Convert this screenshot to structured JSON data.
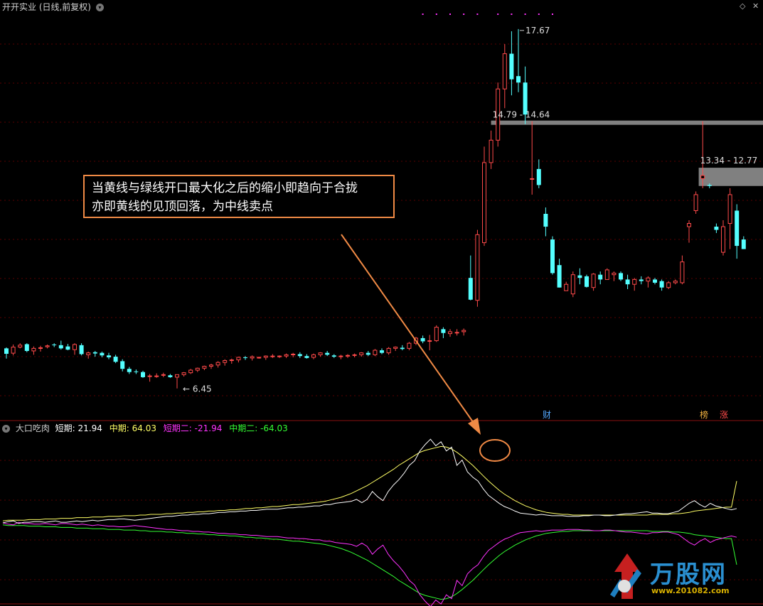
{
  "header": {
    "title": "开开实业 (日线,前复权)",
    "collapse_icon": "chevron-down-icon",
    "corner_icons": [
      "diamond-icon",
      "close-icon"
    ]
  },
  "colors": {
    "up": "#ff4a4a",
    "down": "#54ffff",
    "short_line": "#ffffff",
    "mid_line": "#ffff66",
    "short2_line": "#ff33ff",
    "mid2_line": "#33ff33",
    "grid": "#5a0000",
    "annotation": "#f08a45",
    "resistance_band": "#808080"
  },
  "annotation": {
    "line1": "当黄线与绿线开口最大化之后的缩小即趋向于合拢",
    "line2": "亦即黄线的见顶回落，为中线卖点"
  },
  "price_labels": {
    "high": "17.67",
    "low": "6.45",
    "band1": "14.79 - 14.64",
    "band2": "13.34 - 12.77"
  },
  "markers": {
    "finance": "财",
    "rank": "榜",
    "rise": "涨"
  },
  "indicator": {
    "name": "大口吃肉",
    "items": [
      {
        "label": "短期:",
        "value": "21.94",
        "color": "#ffffff"
      },
      {
        "label": "中期:",
        "value": "64.03",
        "color": "#ffff66"
      },
      {
        "label": "短期二:",
        "value": "-21.94",
        "color": "#ff33ff"
      },
      {
        "label": "中期二:",
        "value": "-64.03",
        "color": "#33ff33"
      }
    ]
  },
  "logo": {
    "text": "万股网",
    "url": "www.201082.com"
  },
  "chart_data": {
    "type": "candlestick",
    "price_range": [
      6.0,
      18.0
    ],
    "x_index_range": [
      0,
      111
    ],
    "candles_ohlc": [
      [
        7.7,
        7.73,
        7.38,
        7.53
      ],
      [
        7.55,
        7.82,
        7.48,
        7.74
      ],
      [
        7.74,
        7.86,
        7.7,
        7.8
      ],
      [
        7.83,
        7.86,
        7.58,
        7.62
      ],
      [
        7.62,
        7.76,
        7.5,
        7.7
      ],
      [
        7.7,
        7.78,
        7.6,
        7.72
      ],
      [
        7.75,
        7.82,
        7.7,
        7.78
      ],
      [
        7.82,
        7.86,
        7.74,
        7.8
      ],
      [
        7.8,
        7.94,
        7.66,
        7.7
      ],
      [
        7.76,
        7.84,
        7.64,
        7.66
      ],
      [
        7.66,
        7.86,
        7.5,
        7.82
      ],
      [
        7.8,
        7.86,
        7.48,
        7.52
      ],
      [
        7.5,
        7.6,
        7.38,
        7.56
      ],
      [
        7.58,
        7.62,
        7.44,
        7.54
      ],
      [
        7.56,
        7.6,
        7.42,
        7.48
      ],
      [
        7.48,
        7.56,
        7.36,
        7.42
      ],
      [
        7.44,
        7.5,
        7.24,
        7.28
      ],
      [
        7.3,
        7.36,
        6.98,
        7.06
      ],
      [
        7.06,
        7.12,
        6.9,
        6.96
      ],
      [
        6.98,
        7.04,
        6.9,
        6.96
      ],
      [
        6.96,
        7.0,
        6.78,
        6.8
      ],
      [
        6.82,
        6.9,
        6.66,
        6.84
      ],
      [
        6.84,
        6.92,
        6.78,
        6.84
      ],
      [
        6.86,
        6.94,
        6.8,
        6.88
      ],
      [
        6.86,
        6.9,
        6.78,
        6.8
      ],
      [
        6.8,
        6.86,
        6.45,
        6.88
      ],
      [
        6.88,
        6.96,
        6.82,
        6.94
      ],
      [
        6.94,
        7.06,
        6.9,
        7.02
      ],
      [
        7.02,
        7.1,
        6.96,
        7.08
      ],
      [
        7.08,
        7.16,
        7.02,
        7.14
      ],
      [
        7.14,
        7.22,
        7.06,
        7.18
      ],
      [
        7.18,
        7.3,
        7.1,
        7.26
      ],
      [
        7.26,
        7.36,
        7.16,
        7.32
      ],
      [
        7.32,
        7.38,
        7.22,
        7.34
      ],
      [
        7.34,
        7.44,
        7.26,
        7.42
      ],
      [
        7.42,
        7.46,
        7.34,
        7.4
      ],
      [
        7.4,
        7.48,
        7.32,
        7.44
      ],
      [
        7.42,
        7.44,
        7.38,
        7.42
      ],
      [
        7.42,
        7.48,
        7.34,
        7.46
      ],
      [
        7.46,
        7.52,
        7.4,
        7.46
      ],
      [
        7.46,
        7.48,
        7.4,
        7.46
      ],
      [
        7.46,
        7.54,
        7.4,
        7.5
      ],
      [
        7.5,
        7.56,
        7.42,
        7.52
      ],
      [
        7.52,
        7.58,
        7.4,
        7.46
      ],
      [
        7.46,
        7.52,
        7.38,
        7.4
      ],
      [
        7.42,
        7.54,
        7.36,
        7.5
      ],
      [
        7.5,
        7.58,
        7.44,
        7.56
      ],
      [
        7.56,
        7.62,
        7.46,
        7.5
      ],
      [
        7.48,
        7.52,
        7.4,
        7.44
      ],
      [
        7.44,
        7.5,
        7.36,
        7.46
      ],
      [
        7.46,
        7.52,
        7.4,
        7.48
      ],
      [
        7.48,
        7.54,
        7.42,
        7.5
      ],
      [
        7.5,
        7.58,
        7.44,
        7.56
      ],
      [
        7.56,
        7.62,
        7.46,
        7.5
      ],
      [
        7.5,
        7.68,
        7.46,
        7.64
      ],
      [
        7.64,
        7.7,
        7.52,
        7.56
      ],
      [
        7.56,
        7.74,
        7.5,
        7.7
      ],
      [
        7.7,
        7.76,
        7.62,
        7.74
      ],
      [
        7.72,
        7.8,
        7.64,
        7.68
      ],
      [
        7.7,
        7.9,
        7.64,
        7.86
      ],
      [
        7.86,
        8.06,
        7.8,
        8.02
      ],
      [
        8.02,
        8.1,
        7.86,
        7.92
      ],
      [
        7.92,
        8.12,
        7.64,
        7.94
      ],
      [
        7.94,
        8.42,
        7.9,
        8.36
      ],
      [
        8.3,
        8.36,
        8.02,
        8.18
      ],
      [
        8.16,
        8.3,
        8.06,
        8.22
      ],
      [
        8.18,
        8.3,
        8.1,
        8.2
      ],
      [
        8.22,
        8.32,
        8.1,
        8.26
      ],
      [
        9.9,
        10.6,
        9.2,
        9.22
      ],
      [
        9.2,
        11.4,
        9.0,
        11.25
      ],
      [
        11.0,
        14.0,
        10.9,
        13.5
      ],
      [
        13.5,
        14.5,
        13.3,
        14.2
      ],
      [
        14.2,
        16.0,
        14.0,
        15.8
      ],
      [
        15.8,
        17.2,
        15.2,
        16.9
      ],
      [
        16.9,
        17.6,
        15.6,
        16.1
      ],
      [
        16.2,
        17.67,
        15.7,
        16.0
      ],
      [
        16.0,
        16.5,
        14.7,
        15.0
      ],
      [
        13.0,
        14.79,
        12.5,
        13.0
      ],
      [
        13.3,
        13.6,
        12.7,
        12.8
      ],
      [
        11.9,
        12.1,
        11.2,
        11.5
      ],
      [
        11.1,
        11.2,
        10.0,
        10.05
      ],
      [
        10.3,
        10.5,
        9.6,
        9.6
      ],
      [
        9.5,
        9.78,
        9.5,
        9.7
      ],
      [
        9.4,
        10.1,
        9.3,
        10.0
      ],
      [
        9.98,
        10.2,
        9.7,
        9.9
      ],
      [
        9.95,
        10.0,
        9.6,
        9.62
      ],
      [
        9.6,
        10.05,
        9.5,
        10.02
      ],
      [
        10.0,
        10.1,
        9.7,
        9.85
      ],
      [
        9.85,
        10.2,
        9.85,
        10.15
      ],
      [
        10.0,
        10.1,
        9.8,
        10.05
      ],
      [
        10.05,
        10.1,
        9.8,
        9.85
      ],
      [
        9.85,
        10.0,
        9.55,
        9.7
      ],
      [
        9.7,
        9.9,
        9.5,
        9.85
      ],
      [
        9.85,
        9.95,
        9.7,
        9.8
      ],
      [
        9.8,
        9.95,
        9.6,
        9.9
      ],
      [
        9.85,
        9.9,
        9.7,
        9.75
      ],
      [
        9.8,
        9.85,
        9.5,
        9.6
      ],
      [
        9.6,
        9.8,
        9.55,
        9.75
      ],
      [
        9.75,
        9.85,
        9.7,
        9.8
      ],
      [
        9.75,
        10.6,
        9.7,
        10.4
      ],
      [
        11.5,
        11.7,
        11.0,
        11.6
      ],
      [
        12.0,
        12.6,
        11.9,
        12.5
      ],
      [
        13.0,
        14.79,
        12.7,
        13.1
      ],
      [
        12.8,
        12.85,
        12.7,
        12.77
      ],
      [
        11.5,
        11.6,
        11.3,
        11.4
      ],
      [
        10.7,
        11.7,
        10.6,
        11.5
      ],
      [
        11.6,
        12.7,
        10.8,
        12.5
      ],
      [
        12.0,
        12.2,
        10.5,
        10.9
      ],
      [
        11.1,
        11.2,
        10.8,
        10.8
      ]
    ],
    "series": [
      {
        "name": "短期",
        "last": 21.94,
        "values": [
          0,
          2,
          3,
          -1,
          1,
          1,
          2,
          2,
          1,
          2,
          3,
          1,
          1,
          2,
          3,
          2,
          3,
          4,
          3,
          4,
          5,
          5,
          6,
          6,
          5,
          4,
          5,
          6,
          7,
          8,
          9,
          10,
          10,
          11,
          12,
          12,
          13,
          13,
          14,
          14,
          15,
          16,
          16,
          17,
          17,
          18,
          18,
          19,
          19,
          20,
          21,
          21,
          21,
          22,
          23,
          23,
          24,
          24,
          25,
          26,
          26,
          28,
          28,
          30,
          31,
          32,
          33,
          36,
          31,
          36,
          48,
          40,
          34,
          48,
          58,
          66,
          76,
          88,
          95,
          110,
          120,
          128,
          118,
          124,
          110,
          116,
          88,
          96,
          78,
          70,
          64,
          52,
          42,
          36,
          30,
          25,
          22,
          18,
          15,
          14,
          13,
          12,
          13,
          12,
          11,
          11,
          11,
          10,
          10,
          10,
          11,
          11,
          12,
          12,
          11,
          11,
          12,
          13,
          14,
          14,
          15,
          16,
          17,
          15,
          15,
          14,
          14,
          16,
          18,
          24,
          30,
          34,
          28,
          24,
          30,
          26,
          24,
          22,
          20,
          21.94
        ]
      },
      {
        "name": "中期",
        "last": 64.03,
        "values": [
          3,
          4,
          4,
          4,
          4,
          5,
          5,
          5,
          6,
          6,
          6,
          7,
          7,
          7,
          8,
          8,
          8,
          9,
          9,
          9,
          10,
          10,
          10,
          11,
          11,
          11,
          12,
          12,
          13,
          13,
          13,
          14,
          14,
          15,
          15,
          16,
          16,
          17,
          17,
          18,
          18,
          19,
          19,
          20,
          20,
          21,
          22,
          22,
          23,
          23,
          24,
          25,
          25,
          26,
          27,
          28,
          28,
          29,
          30,
          31,
          32,
          33,
          35,
          37,
          39,
          42,
          45,
          49,
          53,
          57,
          62,
          67,
          72,
          77,
          82,
          88,
          93,
          98,
          103,
          108,
          111,
          113,
          115,
          117,
          116,
          113,
          108,
          102,
          95,
          88,
          80,
          72,
          64,
          57,
          50,
          44,
          39,
          34,
          30,
          26,
          23,
          20,
          18,
          16,
          15,
          14,
          13,
          13,
          12,
          12,
          12,
          12,
          12,
          12,
          12,
          12,
          12,
          12,
          12,
          12,
          12,
          12,
          12,
          13,
          13,
          13,
          13,
          14,
          14,
          15,
          16,
          18,
          19,
          20,
          21,
          22,
          23,
          24,
          24,
          64.03
        ]
      }
    ],
    "indicator_lines": {
      "短期二": {
        "last": -21.94,
        "mirror_of": "短期"
      },
      "中期二": {
        "last": -64.03,
        "mirror_of": "中期"
      }
    }
  }
}
